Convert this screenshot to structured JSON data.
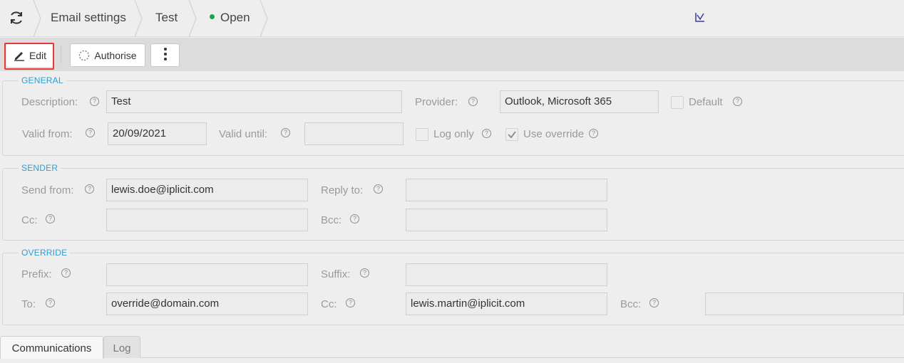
{
  "header": {
    "refresh_icon": "refresh-icon",
    "breadcrumbs": [
      "Email settings",
      "Test"
    ],
    "status": "Open",
    "status_color": "#1aa34a",
    "right_icon": "chart-icon"
  },
  "toolbar": {
    "edit_label": "Edit",
    "authorise_label": "Authorise",
    "more_icon": "more-vertical-icon",
    "highlight_color": "#e53935"
  },
  "general": {
    "title": "GENERAL",
    "description_label": "Description:",
    "description_value": "Test",
    "provider_label": "Provider:",
    "provider_value": "Outlook, Microsoft 365",
    "default_label": "Default",
    "valid_from_label": "Valid from:",
    "valid_from_value": "20/09/2021",
    "valid_until_label": "Valid until:",
    "valid_until_value": "",
    "log_only_label": "Log only",
    "log_only_checked": false,
    "use_override_label": "Use override",
    "use_override_checked": true
  },
  "sender": {
    "title": "SENDER",
    "send_from_label": "Send from:",
    "send_from_value": "lewis.doe@iplicit.com",
    "reply_to_label": "Reply to:",
    "reply_to_value": "",
    "cc_label": "Cc:",
    "cc_value": "",
    "bcc_label": "Bcc:",
    "bcc_value": ""
  },
  "override": {
    "title": "OVERRIDE",
    "prefix_label": "Prefix:",
    "prefix_value": "",
    "suffix_label": "Suffix:",
    "suffix_value": "",
    "to_label": "To:",
    "to_value": "override@domain.com",
    "cc_label": "Cc:",
    "cc_value": "lewis.martin@iplicit.com",
    "bcc_label": "Bcc:",
    "bcc_value": ""
  },
  "tabs": [
    "Communications",
    "Log"
  ],
  "accent_color": "#2a9fd6"
}
